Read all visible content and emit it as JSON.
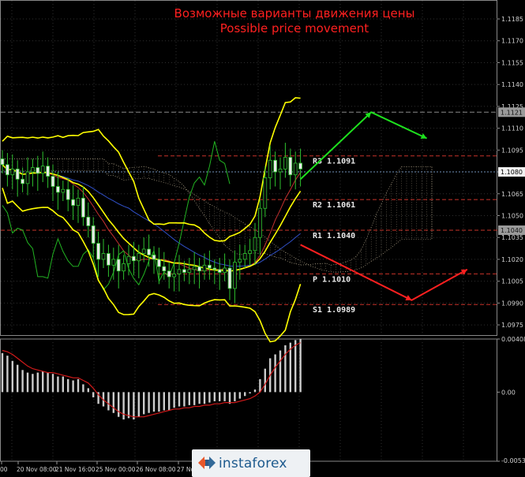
{
  "chart_data": {
    "type": "line",
    "title": "Возможные варианты движения цены",
    "subtitle": "Possible price movement",
    "price_axis": {
      "range": [
        1.0968,
        1.1198
      ],
      "tick_labels": [
        "1.1185",
        "1.1170",
        "1.1155",
        "1.1140",
        "1.1125",
        "1.1110",
        "1.1095",
        "1.1080",
        "1.1065",
        "1.1050",
        "1.1035",
        "1.1020",
        "1.1005",
        "1.0990",
        "1.0975"
      ]
    },
    "current_price_tag": "1.1080",
    "level_tags": [
      {
        "value": 1.1121,
        "text": "1.1121",
        "color": "#9a9a9a"
      },
      {
        "value": 1.104,
        "text": "1.1040",
        "color": "#9a9a9a"
      }
    ],
    "pivot_levels": [
      {
        "label": "R3",
        "value": "1.1091",
        "price": 1.1091
      },
      {
        "label": "R2",
        "value": "1.1061",
        "price": 1.1061
      },
      {
        "label": "R1",
        "value": "1.1040",
        "price": 1.104
      },
      {
        "label": "P",
        "value": "1.1010",
        "price": 1.101
      },
      {
        "label": "S1",
        "value": "1.0989",
        "price": 1.0989
      }
    ],
    "x_tick_labels": [
      "00",
      "20 Nov 08:00",
      "21 Nov 16:00",
      "25 Nov 00:00",
      "26 Nov 08:00",
      "27 No"
    ],
    "close_prices": [
      1.1085,
      1.1078,
      1.1082,
      1.1075,
      1.1072,
      1.108,
      1.1083,
      1.1079,
      1.1084,
      1.1077,
      1.107,
      1.1066,
      1.1068,
      1.1061,
      1.1057,
      1.1062,
      1.1049,
      1.1043,
      1.1031,
      1.102,
      1.1024,
      1.1016,
      1.102,
      1.1012,
      1.1017,
      1.1022,
      1.1019,
      1.1024,
      1.1027,
      1.1023,
      1.102,
      1.1015,
      1.1012,
      1.1008,
      1.101,
      1.1013,
      1.1011,
      1.1013,
      1.1015,
      1.1012,
      1.1016,
      1.1014,
      1.1013,
      1.1011,
      1.1014,
      1.1,
      1.1018,
      1.102,
      1.1024,
      1.1026,
      1.1035,
      1.1055,
      1.1076,
      1.1088,
      1.108,
      1.1082,
      1.109,
      1.1078,
      1.1086,
      1.1082
    ],
    "forecast_paths": [
      {
        "color": "#1ee11e",
        "points": [
          [
            1.1075,
            0
          ],
          [
            1.1121,
            14
          ],
          [
            1.1103,
            25
          ]
        ]
      },
      {
        "color": "#ff2020",
        "points": [
          [
            1.103,
            0
          ],
          [
            1.0992,
            22
          ],
          [
            1.1013,
            33
          ]
        ]
      }
    ],
    "macd": {
      "range": [
        -0.00531,
        0.00408
      ],
      "tick_labels": [
        "0.00408",
        "0.00",
        "-0.00531"
      ],
      "histogram": [
        0.003,
        0.0028,
        0.0024,
        0.0021,
        0.0017,
        0.0015,
        0.0014,
        0.0015,
        0.0016,
        0.0015,
        0.0014,
        0.0012,
        0.0012,
        0.001,
        0.0009,
        0.001,
        0.0006,
        0.0003,
        -0.0004,
        -0.0009,
        -0.0011,
        -0.0014,
        -0.0016,
        -0.0019,
        -0.0021,
        -0.002,
        -0.0021,
        -0.0019,
        -0.0017,
        -0.0016,
        -0.0015,
        -0.0015,
        -0.0014,
        -0.0014,
        -0.0012,
        -0.0011,
        -0.0011,
        -0.001,
        -0.001,
        -0.0009,
        -0.0009,
        -0.0008,
        -0.0007,
        -0.0007,
        -0.0007,
        -0.0009,
        -0.0007,
        -0.0005,
        -0.0003,
        -0.0001,
        0.0002,
        0.001,
        0.0018,
        0.0026,
        0.0029,
        0.0032,
        0.0036,
        0.0038,
        0.004,
        0.0041
      ],
      "signal": [
        0.0032,
        0.0031,
        0.0029,
        0.0026,
        0.0023,
        0.002,
        0.0018,
        0.0017,
        0.0016,
        0.0015,
        0.0015,
        0.0014,
        0.0013,
        0.0012,
        0.0011,
        0.0011,
        0.0009,
        0.0007,
        0.0003,
        -0.0002,
        -0.0006,
        -0.0009,
        -0.0012,
        -0.0015,
        -0.0017,
        -0.0018,
        -0.0019,
        -0.0019,
        -0.0019,
        -0.0018,
        -0.0017,
        -0.0016,
        -0.0015,
        -0.0014,
        -0.0013,
        -0.0013,
        -0.0012,
        -0.0012,
        -0.0011,
        -0.0011,
        -0.001,
        -0.001,
        -0.0009,
        -0.0009,
        -0.0008,
        -0.0008,
        -0.0008,
        -0.0007,
        -0.0006,
        -0.0005,
        -0.0003,
        0.0,
        0.0006,
        0.0013,
        0.0019,
        0.0024,
        0.0029,
        0.0033,
        0.0036,
        0.0038
      ]
    },
    "colors": {
      "title": "#ff2020",
      "bollinger": "#ffff00",
      "candles": "#2ec12e",
      "ichimoku_cloud": "#d9c9a8",
      "lagging_line": "#22b522",
      "pivot_lines": "#c8332a",
      "macd_histogram": "#cccccc",
      "macd_signal": "#d11a1a"
    },
    "grid": true
  },
  "watermark": {
    "text": "instaforex"
  }
}
